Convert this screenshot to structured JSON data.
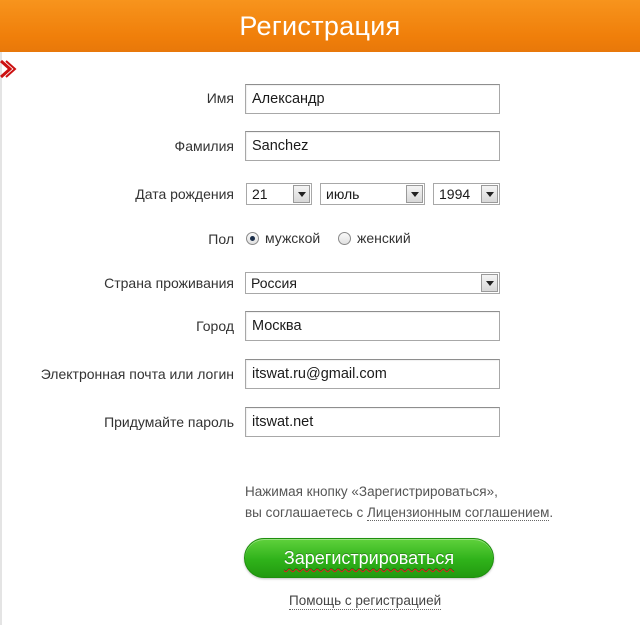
{
  "header": {
    "title": "Регистрация"
  },
  "form": {
    "first_name": {
      "label": "Имя",
      "value": "Александр"
    },
    "last_name": {
      "label": "Фамилия",
      "value": "Sanchez"
    },
    "birth_date": {
      "label": "Дата рождения",
      "day": "21",
      "month": "июль",
      "year": "1994"
    },
    "gender": {
      "label": "Пол",
      "options": [
        {
          "label": "мужской",
          "checked": true
        },
        {
          "label": "женский",
          "checked": false
        }
      ]
    },
    "country": {
      "label": "Страна проживания",
      "value": "Россия"
    },
    "city": {
      "label": "Город",
      "value": "Москва"
    },
    "email": {
      "label": "Электронная почта или логин",
      "value": "itswat.ru@gmail.com"
    },
    "password": {
      "label": "Придумайте пароль",
      "value": "itswat.net"
    }
  },
  "agreement": {
    "line1": "Нажимая кнопку «Зарегистрироваться»,",
    "line2_prefix": "вы соглашаетесь с ",
    "link": "Лицензионным соглашением",
    "line2_suffix": "."
  },
  "buttons": {
    "register": "Зарегистрироваться",
    "help": "Помощь с регистрацией"
  },
  "colors": {
    "header": "#f7941d",
    "button": "#2fb21a"
  }
}
